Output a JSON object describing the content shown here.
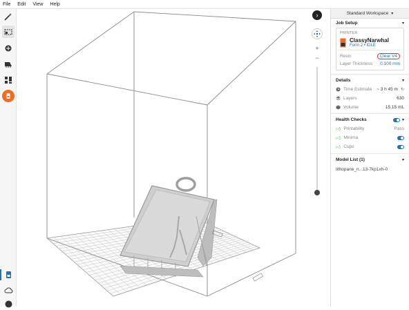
{
  "menu": [
    "File",
    "Edit",
    "View",
    "Help"
  ],
  "tools": [
    {
      "icon": "magic-wand-icon"
    },
    {
      "icon": "select-icon"
    },
    {
      "icon": "orientation-icon"
    },
    {
      "icon": "supports-icon"
    },
    {
      "icon": "layout-icon"
    },
    {
      "icon": "printer-icon"
    }
  ],
  "viewport_controls": {
    "collapse": "›",
    "plus": "+",
    "minus": "−",
    "dots": "⋮"
  },
  "panel": {
    "workspace": "Standard Workspace",
    "job_setup": "Job Setup",
    "printer_label": "PRINTER",
    "printer_name": "ClassyNarwhal",
    "printer_model": "Form 2",
    "printer_status": "IDLE",
    "resin_label": "Resin",
    "resin_value": "Clear V4",
    "layer_label": "Layer Thickness",
    "layer_value": "0.100 mm",
    "details": "Details",
    "time_label": "Time Estimate",
    "time_value": "~ 3 h 45 m",
    "layers_label": "Layers",
    "layers_value": "630",
    "volume_label": "Volume",
    "volume_value": "15.15 mL",
    "health": "Health Checks",
    "printability_label": "Printability",
    "printability_value": "Pass",
    "minima_label": "Minima",
    "cups_label": "Cups",
    "model_list": "Model List (1)",
    "model_item": "lithopane_n...13-7kp1xh-0"
  },
  "colors": {
    "accent": "#1e73be",
    "brand_orange": "#f26b21",
    "check_green": "#4caf50"
  }
}
